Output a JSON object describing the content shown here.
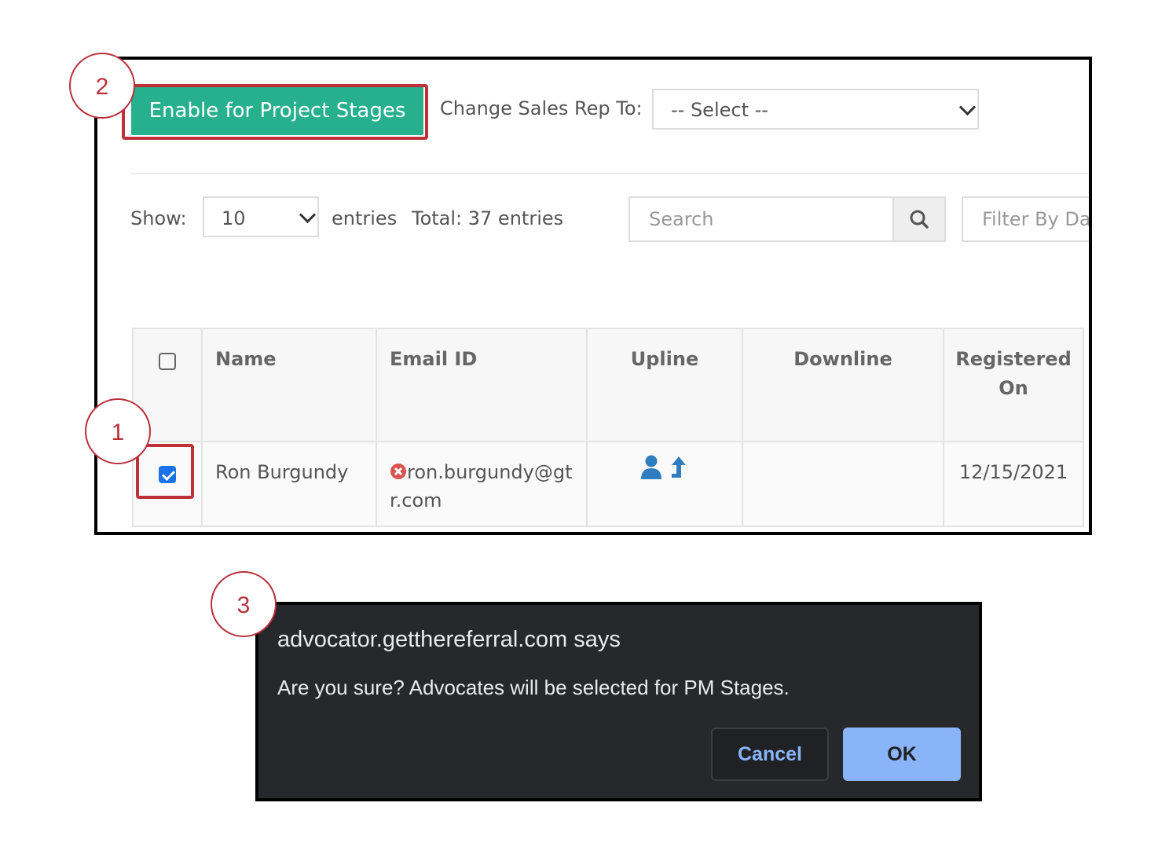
{
  "toolbar": {
    "enable_button": "Enable for Project Stages",
    "sales_rep_label": "Change Sales Rep To:",
    "sales_rep_select": "-- Select --"
  },
  "list_controls": {
    "show_label": "Show:",
    "entries_value": "10",
    "entries_label": "entries",
    "total_label": "Total:  37 entries",
    "search_placeholder": "Search",
    "filter_placeholder": "Filter By Da"
  },
  "table": {
    "headers": [
      "Name",
      "Email ID",
      "Upline",
      "Downline",
      "Registered On"
    ],
    "rows": [
      {
        "checked": true,
        "name": "Ron Burgundy",
        "email": "ron.burgundy@gtr.com",
        "email_status": "invalid",
        "downline": "",
        "registered_on": "12/15/2021"
      }
    ]
  },
  "callouts": [
    "1",
    "2",
    "3"
  ],
  "dialog": {
    "title": "advocator.getthereferral.com says",
    "message": "Are you sure? Advocates will be selected for PM Stages.",
    "cancel_label": "Cancel",
    "ok_label": "OK"
  },
  "colors": {
    "enable_button": "#26b08e",
    "highlight": "#c0303a",
    "dialog_bg": "#27282c",
    "ok_button": "#8ab4f8",
    "checkbox_checked": "#1a73e8",
    "upline_icon": "#2f7dbf",
    "error_icon": "#d9534f"
  },
  "icons": [
    "chevron-down-icon",
    "search-icon",
    "user-icon",
    "arrow-up-icon",
    "error-circle-icon",
    "checkbox-checked-icon"
  ]
}
